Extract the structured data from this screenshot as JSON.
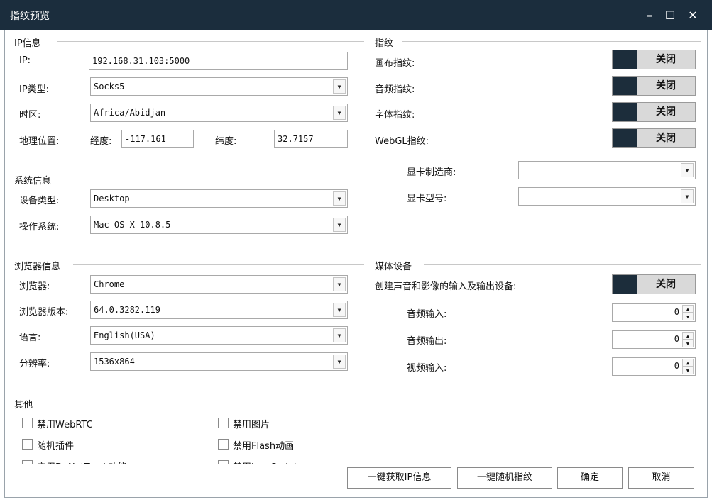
{
  "window": {
    "title": "指纹预览",
    "minimize": "–",
    "maximize": "☐",
    "close": "✕"
  },
  "ip_section": {
    "title": "IP信息",
    "ip_label": "IP:",
    "ip_value": "192.168.31.103:5000",
    "type_label": "IP类型:",
    "type_value": "Socks5",
    "timezone_label": "时区:",
    "timezone_value": "Africa/Abidjan",
    "geo_label": "地理位置:",
    "lng_label": "经度:",
    "lng_value": "-117.161",
    "lat_label": "纬度:",
    "lat_value": "32.7157"
  },
  "system_section": {
    "title": "系统信息",
    "device_label": "设备类型:",
    "device_value": "Desktop",
    "os_label": "操作系统:",
    "os_value": "Mac OS X 10.8.5"
  },
  "browser_section": {
    "title": "浏览器信息",
    "browser_label": "浏览器:",
    "browser_value": "Chrome",
    "version_label": "浏览器版本:",
    "version_value": "64.0.3282.119",
    "language_label": "语言:",
    "language_value": "English(USA)",
    "resolution_label": "分辨率:",
    "resolution_value": "1536x864"
  },
  "other_section": {
    "title": "其他",
    "options": [
      "禁用WebRTC",
      "禁用图片",
      "随机插件",
      "禁用Flash动画",
      "启用DoNotTrack功能",
      "禁用JavaScript"
    ]
  },
  "fingerprint_section": {
    "title": "指纹",
    "canvas_label": "画布指纹:",
    "audio_label": "音频指纹:",
    "font_label": "字体指纹:",
    "webgl_label": "WebGL指纹:",
    "toggle_off_text": "关闭",
    "gpu_vendor_label": "显卡制造商:",
    "gpu_vendor_value": "",
    "gpu_model_label": "显卡型号:",
    "gpu_model_value": ""
  },
  "media_section": {
    "title": "媒体设备",
    "create_label": "创建声音和影像的输入及输出设备:",
    "audio_in_label": "音频输入:",
    "audio_in_value": "0",
    "audio_out_label": "音频输出:",
    "audio_out_value": "0",
    "video_in_label": "视频输入:",
    "video_in_value": "0"
  },
  "footer": {
    "get_ip_label": "一键获取IP信息",
    "random_label": "一键随机指纹",
    "ok_label": "确定",
    "cancel_label": "取消"
  },
  "colors": {
    "titlebar": "#1b2d3d",
    "toggle_dark": "#1c2d3b",
    "toggle_off_bg": "#d9d9d9"
  }
}
